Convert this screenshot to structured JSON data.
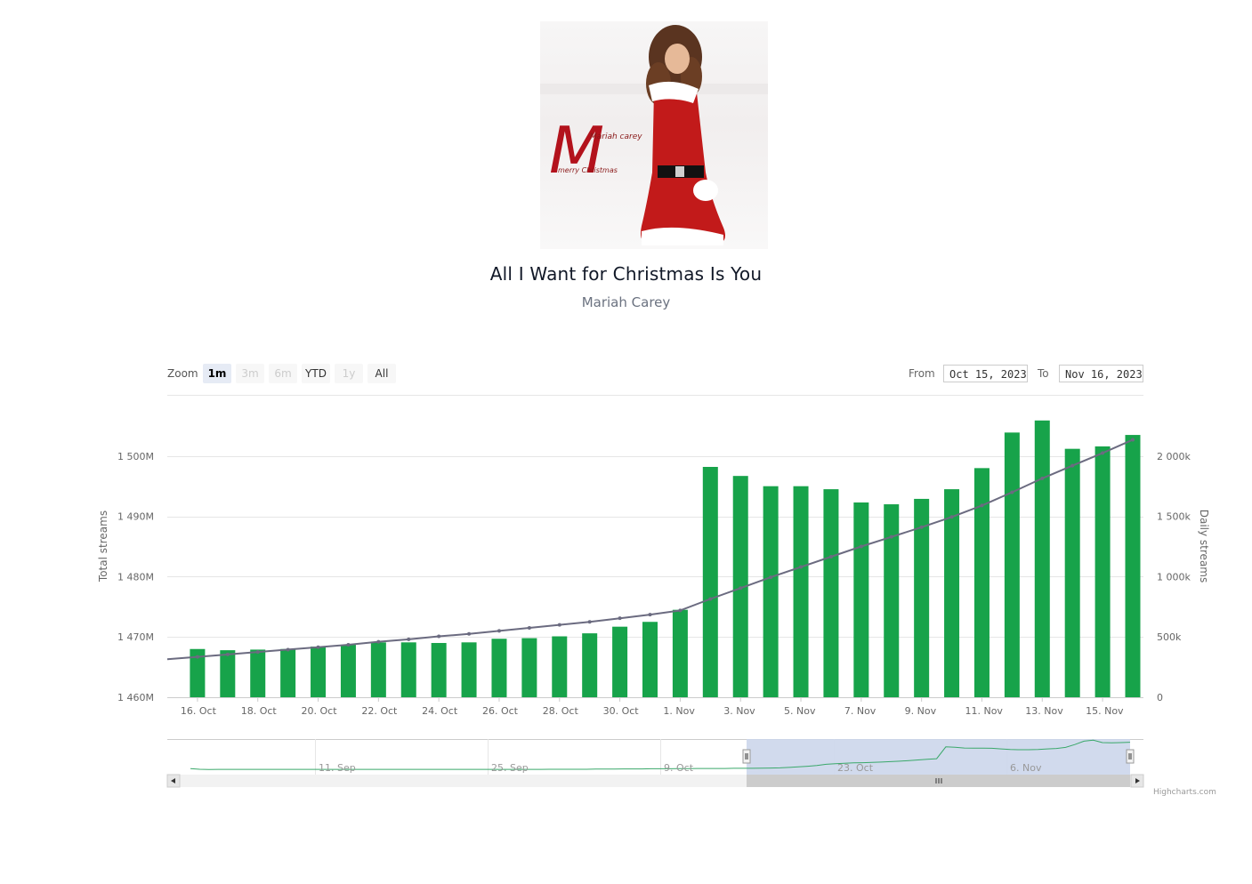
{
  "song": {
    "title": "All I Want for Christmas Is You",
    "artist": "Mariah Carey"
  },
  "cover": {
    "brand_line1": "Mariah carey",
    "brand_line2": "merry Christmas"
  },
  "range_selector": {
    "zoom_label": "Zoom",
    "buttons": [
      {
        "label": "1m",
        "state": "active"
      },
      {
        "label": "3m",
        "state": "disabled"
      },
      {
        "label": "6m",
        "state": "disabled"
      },
      {
        "label": "YTD",
        "state": "normal"
      },
      {
        "label": "1y",
        "state": "disabled"
      },
      {
        "label": "All",
        "state": "normal"
      }
    ],
    "from_label": "From",
    "from_value": "Oct 15, 2023",
    "to_label": "To",
    "to_value": "Nov 16, 2023"
  },
  "credits": "Highcharts.com",
  "colors": {
    "bars": "#17a34a",
    "line": "#6b6b80",
    "navigator_fill": "#ccd6eb",
    "navigator_line": "#3aa86a"
  },
  "chart_data": {
    "type": "bar",
    "x": [
      "2023-10-15",
      "2023-10-16",
      "2023-10-17",
      "2023-10-18",
      "2023-10-19",
      "2023-10-20",
      "2023-10-21",
      "2023-10-22",
      "2023-10-23",
      "2023-10-24",
      "2023-10-25",
      "2023-10-26",
      "2023-10-27",
      "2023-10-28",
      "2023-10-29",
      "2023-10-30",
      "2023-10-31",
      "2023-11-01",
      "2023-11-02",
      "2023-11-03",
      "2023-11-04",
      "2023-11-05",
      "2023-11-06",
      "2023-11-07",
      "2023-11-08",
      "2023-11-09",
      "2023-11-10",
      "2023-11-11",
      "2023-11-12",
      "2023-11-13",
      "2023-11-14",
      "2023-11-15",
      "2023-11-16"
    ],
    "x_ticks": [
      "16. Oct",
      "18. Oct",
      "20. Oct",
      "22. Oct",
      "24. Oct",
      "26. Oct",
      "28. Oct",
      "30. Oct",
      "1. Nov",
      "3. Nov",
      "5. Nov",
      "7. Nov",
      "9. Nov",
      "11. Nov",
      "13. Nov",
      "15. Nov"
    ],
    "series": [
      {
        "name": "Daily streams",
        "type": "bar",
        "axis": "right",
        "values": [
          null,
          400000,
          390000,
          395000,
          400000,
          420000,
          435000,
          455000,
          455000,
          450000,
          455000,
          485000,
          490000,
          505000,
          530000,
          585000,
          625000,
          725000,
          1910000,
          1835000,
          1750000,
          1750000,
          1725000,
          1615000,
          1600000,
          1645000,
          1725000,
          1900000,
          2195000,
          2295000,
          2060000,
          2080000,
          2175000
        ]
      },
      {
        "name": "Total streams",
        "type": "line",
        "axis": "left",
        "values": [
          1466.3,
          1466.7,
          1467.1,
          1467.5,
          1467.9,
          1468.3,
          1468.7,
          1469.2,
          1469.6,
          1470.1,
          1470.5,
          1471.0,
          1471.5,
          1472.0,
          1472.5,
          1473.1,
          1473.7,
          1474.4,
          1476.3,
          1478.1,
          1479.9,
          1481.6,
          1483.3,
          1485.0,
          1486.6,
          1488.2,
          1489.9,
          1491.8,
          1494.0,
          1496.3,
          1498.4,
          1500.5,
          1502.7
        ]
      }
    ],
    "ylabel_left": "Total streams",
    "ylabel_right": "Daily streams",
    "ylim_left": [
      1460,
      1510
    ],
    "ylim_right": [
      0,
      2500000
    ],
    "y_ticks_left": [
      "1 460M",
      "1 470M",
      "1 480M",
      "1 490M",
      "1 500M"
    ],
    "y_ticks_right": [
      "0",
      "500k",
      "1 000k",
      "1 500k",
      "2 000k"
    ],
    "grid": true,
    "navigator": {
      "ticks": [
        "11. Sep",
        "25. Sep",
        "9. Oct",
        "23. Oct",
        "6. Nov"
      ],
      "values": [
        100,
        60,
        40,
        50,
        50,
        50,
        50,
        50,
        50,
        50,
        50,
        50,
        50,
        50,
        50,
        50,
        50,
        50,
        50,
        50,
        50,
        50,
        50,
        50,
        50,
        50,
        50,
        50,
        50,
        50,
        50,
        50,
        50,
        50,
        50,
        50,
        50,
        50,
        50,
        60,
        60,
        60,
        60,
        60,
        70,
        70,
        70,
        80,
        80,
        80,
        90,
        90,
        90,
        100,
        100,
        110,
        110,
        110,
        110,
        120,
        120,
        120,
        130,
        140,
        150,
        180,
        220,
        250,
        300,
        380,
        420,
        450,
        470,
        480,
        500,
        520,
        550,
        580,
        620,
        660,
        700,
        740,
        1500,
        1480,
        1430,
        1420,
        1420,
        1410,
        1370,
        1330,
        1320,
        1320,
        1330,
        1370,
        1400,
        1470,
        1650,
        1870,
        1930,
        1780,
        1760,
        1780,
        1800
      ]
    }
  }
}
